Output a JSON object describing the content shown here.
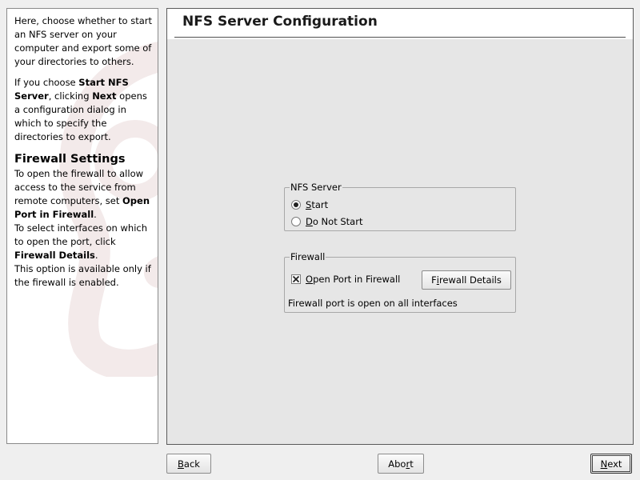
{
  "help": {
    "intro": "Here, choose whether to start an NFS server on your computer and export some of your directories to others.",
    "p2_a": "If you choose ",
    "p2_b": "Start NFS Server",
    "p2_c": ", clicking ",
    "p2_d": "Next",
    "p2_e": " opens a configuration dialog in which to specify the directories to export.",
    "firewall_heading": "Firewall Settings",
    "p3_a": "To open the firewall to allow access to the service from remote computers, set ",
    "p3_b": "Open Port in Firewall",
    "p3_c": ".",
    "p4_a": "To select interfaces on which to open the port, click ",
    "p4_b": "Firewall Details",
    "p4_c": ".",
    "p5": "This option is available only if the firewall is enabled."
  },
  "main": {
    "title": "NFS Server Configuration",
    "nfs_group": {
      "legend": "NFS Server",
      "start": {
        "mnemonic": "S",
        "rest": "tart",
        "checked": true
      },
      "do_not_start": {
        "mnemonic": "D",
        "rest": "o Not Start",
        "checked": false
      }
    },
    "firewall_group": {
      "legend": "Firewall",
      "open_port": {
        "mnemonic": "O",
        "rest": "pen Port in Firewall",
        "checked": true
      },
      "details_button": {
        "pre": "F",
        "mnemonic": "i",
        "rest": "rewall Details"
      },
      "status": "Firewall port is open on all interfaces"
    }
  },
  "footer": {
    "back": {
      "mnemonic": "B",
      "rest": "ack"
    },
    "abort": {
      "pre": "Abo",
      "mnemonic": "r",
      "rest": "t"
    },
    "next": {
      "mnemonic": "N",
      "rest": "ext"
    }
  },
  "colors": {
    "help_bg": "#ffffff",
    "main_bg": "#e6e6e6",
    "watermark": "#f3eaea"
  },
  "icons": {
    "watermark": "suse-gecko-watermark-icon",
    "checkbox_mark": "x-check-icon"
  }
}
